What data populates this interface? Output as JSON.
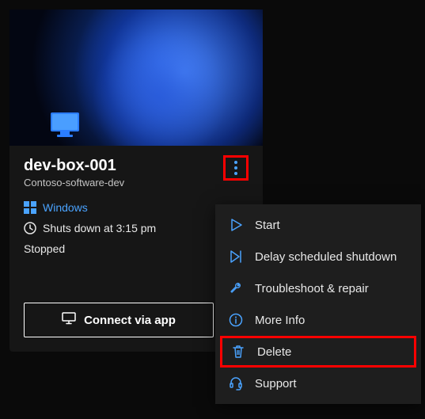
{
  "devbox": {
    "name": "dev-box-001",
    "project": "Contoso-software-dev",
    "os_label": "Windows",
    "schedule_text": "Shuts down at 3:15 pm",
    "status": "Stopped",
    "connect_label": "Connect via app"
  },
  "menu": {
    "start": "Start",
    "delay": "Delay scheduled shutdown",
    "troubleshoot": "Troubleshoot & repair",
    "more_info": "More Info",
    "delete": "Delete",
    "support": "Support"
  },
  "colors": {
    "accent": "#4aa3ff",
    "highlight": "#ff0000"
  }
}
